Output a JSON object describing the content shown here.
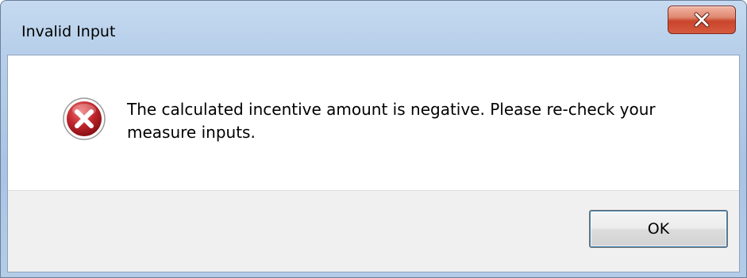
{
  "dialog": {
    "title": "Invalid Input",
    "message": "The calculated incentive amount is negative. Please re-check your measure inputs.",
    "ok_label": "OK",
    "icon": "error-icon",
    "close_icon": "close-icon"
  },
  "colors": {
    "close_button": "#c9452c",
    "error_icon": "#c1272d",
    "frame": "#b7cfea"
  }
}
